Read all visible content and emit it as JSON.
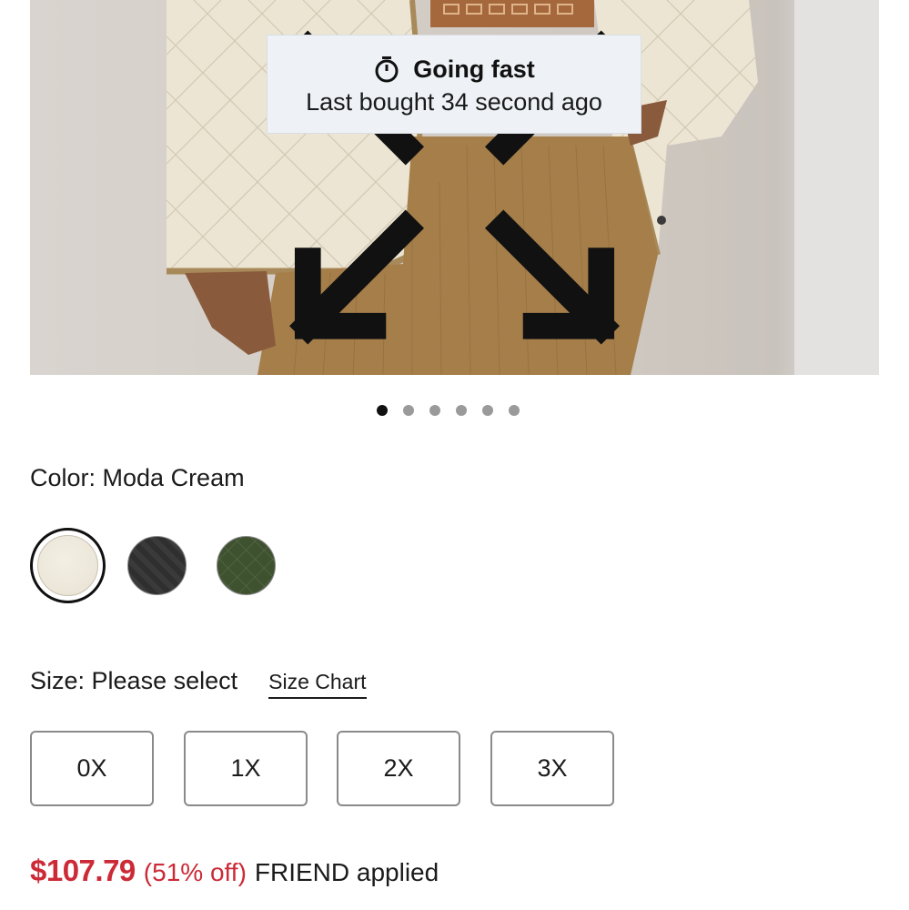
{
  "product_image": {
    "alt": "Model wearing quilted cream jacket and tan corduroy pants",
    "expand_icon": "expand-arrows-icon"
  },
  "badge": {
    "icon": "timer-icon",
    "title": "Going fast",
    "subtitle": "Last bought 34 second ago"
  },
  "carousel": {
    "total": 6,
    "active_index": 0
  },
  "color": {
    "label": "Color: Moda Cream",
    "swatches": [
      {
        "name": "Moda Cream",
        "hex": "#ebe6d8",
        "selected": true
      },
      {
        "name": "Black",
        "hex": "#333333",
        "selected": false
      },
      {
        "name": "Olive",
        "hex": "#3f5230",
        "selected": false
      }
    ]
  },
  "size": {
    "label": "Size: Please select",
    "chart_link": "Size Chart",
    "options": [
      "0X",
      "1X",
      "2X",
      "3X"
    ]
  },
  "price": {
    "amount": "$107.79",
    "discount": "(51% off)",
    "promo": "FRIEND applied",
    "accent_color": "#cc2a36"
  }
}
